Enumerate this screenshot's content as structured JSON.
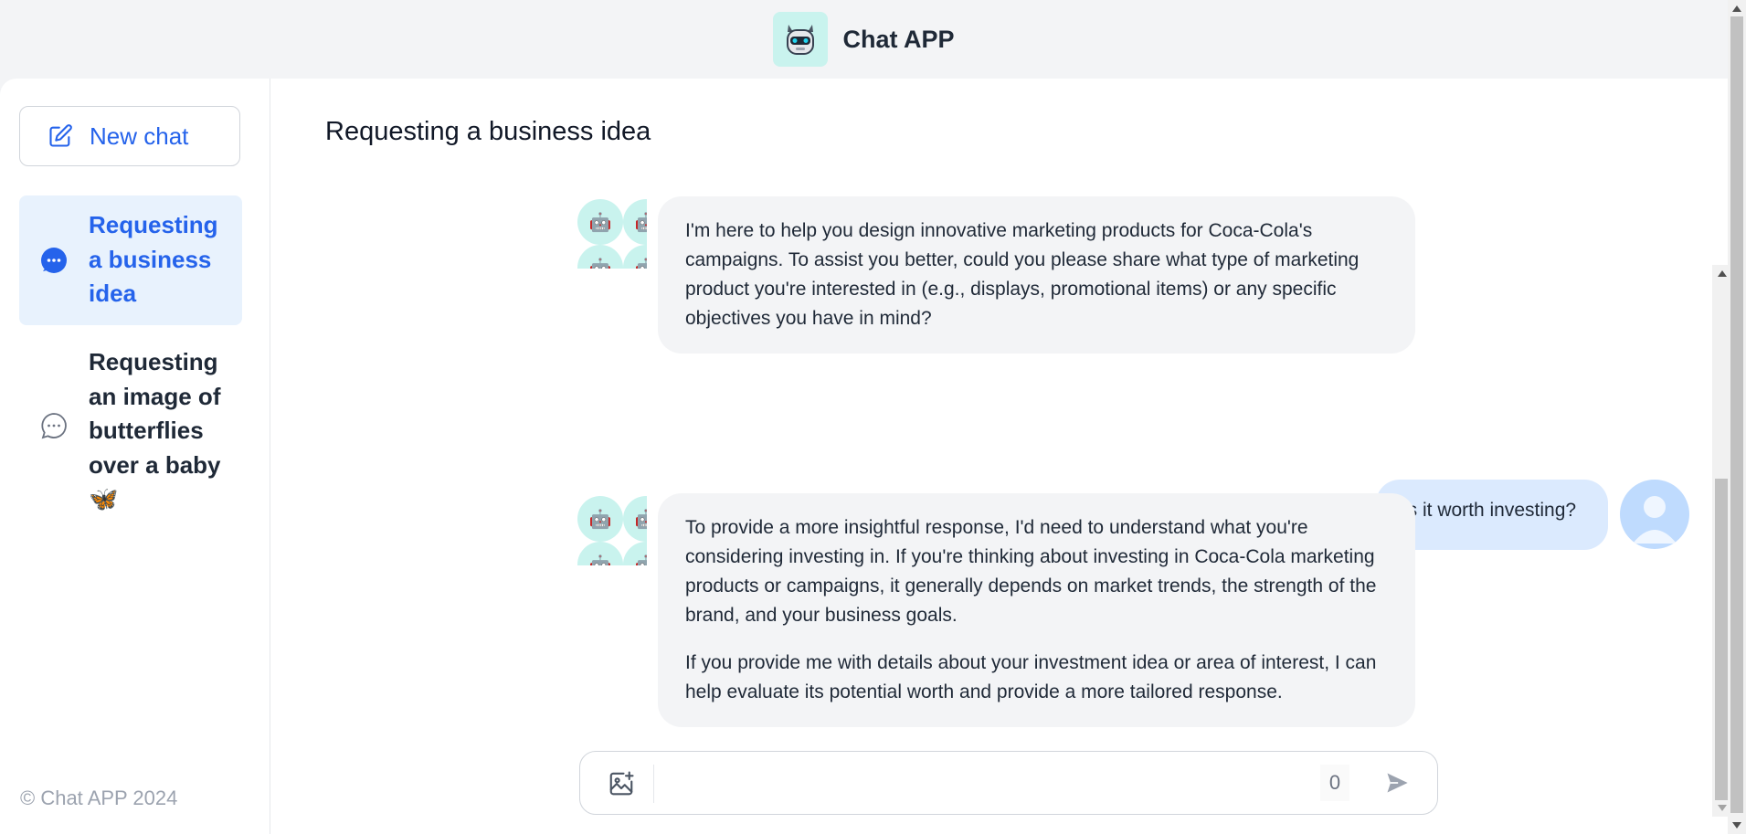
{
  "app": {
    "title": "Chat APP",
    "logo_icon": "robot-icon"
  },
  "sidebar": {
    "new_chat_label": "New chat",
    "new_chat_icon": "pencil-square-icon",
    "conversations": [
      {
        "label": "Requesting a business idea",
        "icon": "chat-bubble-icon",
        "active": true
      },
      {
        "label": "Requesting an image of butterflies over a baby 🦋",
        "icon": "chat-bubble-outline-icon",
        "active": false
      }
    ],
    "copyright": "© Chat APP 2024"
  },
  "chat": {
    "title": "Requesting a business idea",
    "messages": [
      {
        "role": "assistant",
        "paragraphs": [
          "I'm here to help you design innovative marketing products for Coca-Cola's campaigns. To assist you better, could you please share what type of marketing product you're interested in (e.g., displays, promotional items) or any specific objectives you have in mind?"
        ]
      },
      {
        "role": "user",
        "paragraphs": [
          "is it worth investing?"
        ]
      },
      {
        "role": "assistant",
        "paragraphs": [
          "To provide a more insightful response, I'd need to understand what you're considering investing in. If you're thinking about investing in Coca-Cola marketing products or campaigns, it generally depends on market trends, the strength of the brand, and your business goals.",
          "If you provide me with details about your investment idea or area of interest, I can help evaluate its potential worth and provide a more tailored response."
        ]
      }
    ]
  },
  "composer": {
    "placeholder": "",
    "value": "",
    "char_count": "0",
    "image_icon": "add-image-icon",
    "send_icon": "send-icon"
  },
  "colors": {
    "accent": "#2563eb",
    "active_bg": "#e8f2fd",
    "assistant_bubble": "#f3f4f6",
    "user_bubble": "#dbeafe",
    "bot_avatar_bg": "#c9f3ee"
  }
}
